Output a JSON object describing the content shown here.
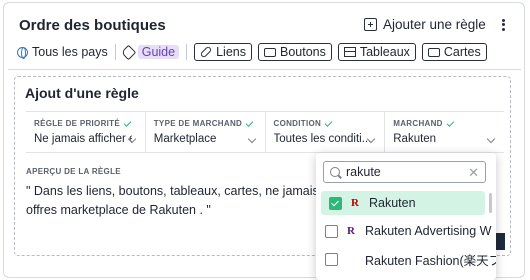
{
  "header": {
    "title": "Ordre des boutiques",
    "add_rule_label": "Ajouter une règle"
  },
  "filters": {
    "country": "Tous les pays",
    "guide": "Guide",
    "chips": [
      "Liens",
      "Boutons",
      "Tableaux",
      "Cartes"
    ]
  },
  "rule": {
    "title": "Ajout d'une règle",
    "fields": [
      {
        "label": "RÈGLE DE PRIORITÉ",
        "value": "Ne jamais afficher e..."
      },
      {
        "label": "TYPE DE MARCHAND",
        "value": "Marketplace"
      },
      {
        "label": "CONDITION",
        "value": "Toutes les conditi..."
      },
      {
        "label": "MARCHAND",
        "value": "Rakuten"
      }
    ],
    "preview_label": "APERÇU DE LA RÈGLE",
    "preview_line1": "\" Dans les liens, boutons, tableaux, cartes, ne jamais affi",
    "preview_line2": "offres marketplace de Rakuten . \""
  },
  "dropdown": {
    "search_value": "rakute",
    "options": [
      {
        "label": "Rakuten",
        "logo": "R",
        "selected": true
      },
      {
        "label": "Rakuten Advertising W",
        "logo": "R",
        "selected": false
      },
      {
        "label": "Rakuten Fashion(楽天フ",
        "logo": "",
        "selected": false
      }
    ]
  },
  "colors": {
    "accent_green": "#2fb679",
    "guide_bg": "#e6ddf7",
    "guide_text": "#6a3fb8",
    "rakuten_red": "#bf0000"
  }
}
